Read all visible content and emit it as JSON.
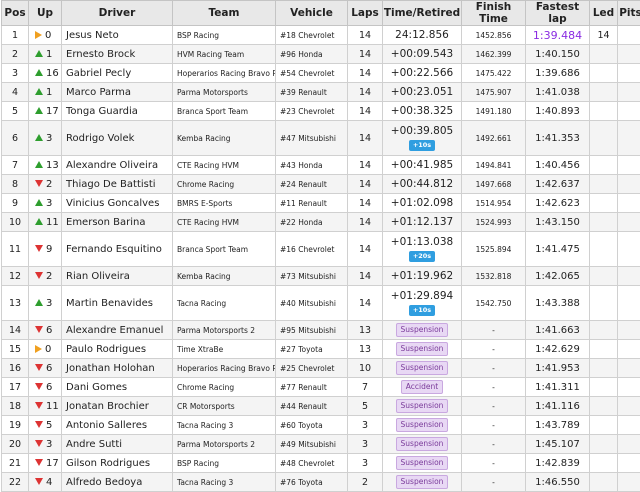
{
  "headers": [
    "Pos",
    "Up",
    "Driver",
    "Team",
    "Vehicle",
    "Laps",
    "Time/Retired",
    "Finish Time",
    "Fastest lap",
    "Led",
    "Pits"
  ],
  "rows": [
    {
      "pos": "1",
      "dir": "same",
      "up": "0",
      "driver": "Jesus Neto",
      "team": "BSP Racing",
      "vehicle": "#18 Chevrolet",
      "laps": "14",
      "time": "24:12.856",
      "finish": "1452.856",
      "fast": "1:39.484",
      "led": "14",
      "pits": "",
      "best": true
    },
    {
      "pos": "2",
      "dir": "up",
      "up": "1",
      "driver": "Ernesto Brock",
      "team": "HVM Racing Team",
      "vehicle": "#96 Honda",
      "laps": "14",
      "time": "+00:09.543",
      "finish": "1462.399",
      "fast": "1:40.150",
      "led": "",
      "pits": ""
    },
    {
      "pos": "3",
      "dir": "up",
      "up": "16",
      "driver": "Gabriel Pecly",
      "team": "Hoperarios Racing Bravo Racing",
      "vehicle": "#54 Chevrolet",
      "laps": "14",
      "time": "+00:22.566",
      "finish": "1475.422",
      "fast": "1:39.686",
      "led": "",
      "pits": ""
    },
    {
      "pos": "4",
      "dir": "up",
      "up": "1",
      "driver": "Marco Parma",
      "team": "Parma Motorsports",
      "vehicle": "#39 Renault",
      "laps": "14",
      "time": "+00:23.051",
      "finish": "1475.907",
      "fast": "1:41.038",
      "led": "",
      "pits": ""
    },
    {
      "pos": "5",
      "dir": "up",
      "up": "17",
      "driver": "Tonga Guardia",
      "team": "Branca Sport Team",
      "vehicle": "#23 Chevrolet",
      "laps": "14",
      "time": "+00:38.325",
      "finish": "1491.180",
      "fast": "1:40.893",
      "led": "",
      "pits": ""
    },
    {
      "pos": "6",
      "dir": "up",
      "up": "3",
      "driver": "Rodrigo Volek",
      "team": "Kemba Racing",
      "vehicle": "#47 Mitsubishi",
      "laps": "14",
      "time": "+00:39.805",
      "penalty": "+10s",
      "finish": "1492.661",
      "fast": "1:41.353",
      "led": "",
      "pits": ""
    },
    {
      "pos": "7",
      "dir": "up",
      "up": "13",
      "driver": "Alexandre Oliveira",
      "team": "CTE Racing HVM",
      "vehicle": "#43 Honda",
      "laps": "14",
      "time": "+00:41.985",
      "finish": "1494.841",
      "fast": "1:40.456",
      "led": "",
      "pits": ""
    },
    {
      "pos": "8",
      "dir": "down",
      "up": "2",
      "driver": "Thiago De Battisti",
      "team": "Chrome Racing",
      "vehicle": "#24 Renault",
      "laps": "14",
      "time": "+00:44.812",
      "finish": "1497.668",
      "fast": "1:42.637",
      "led": "",
      "pits": ""
    },
    {
      "pos": "9",
      "dir": "up",
      "up": "3",
      "driver": "Vinicius Goncalves",
      "team": "BMRS E-Sports",
      "vehicle": "#11 Renault",
      "laps": "14",
      "time": "+01:02.098",
      "finish": "1514.954",
      "fast": "1:42.623",
      "led": "",
      "pits": ""
    },
    {
      "pos": "10",
      "dir": "up",
      "up": "11",
      "driver": "Emerson Barina",
      "team": "CTE Racing HVM",
      "vehicle": "#22 Honda",
      "laps": "14",
      "time": "+01:12.137",
      "finish": "1524.993",
      "fast": "1:43.150",
      "led": "",
      "pits": ""
    },
    {
      "pos": "11",
      "dir": "down",
      "up": "9",
      "driver": "Fernando Esquitino",
      "team": "Branca Sport Team",
      "vehicle": "#16 Chevrolet",
      "laps": "14",
      "time": "+01:13.038",
      "penalty": "+20s",
      "finish": "1525.894",
      "fast": "1:41.475",
      "led": "",
      "pits": ""
    },
    {
      "pos": "12",
      "dir": "down",
      "up": "2",
      "driver": "Rian Oliveira",
      "team": "Kemba Racing",
      "vehicle": "#73 Mitsubishi",
      "laps": "14",
      "time": "+01:19.962",
      "finish": "1532.818",
      "fast": "1:42.065",
      "led": "",
      "pits": ""
    },
    {
      "pos": "13",
      "dir": "up",
      "up": "3",
      "driver": "Martin Benavides",
      "team": "Tacna Racing",
      "vehicle": "#40 Mitsubishi",
      "laps": "14",
      "time": "+01:29.894",
      "penalty": "+10s",
      "finish": "1542.750",
      "fast": "1:43.388",
      "led": "",
      "pits": ""
    },
    {
      "pos": "14",
      "dir": "down",
      "up": "6",
      "driver": "Alexandre Emanuel",
      "team": "Parma Motorsports 2",
      "vehicle": "#95 Mitsubishi",
      "laps": "13",
      "status": "Suspension",
      "finish": "-",
      "fast": "1:41.663",
      "led": "",
      "pits": ""
    },
    {
      "pos": "15",
      "dir": "same",
      "up": "0",
      "driver": "Paulo Rodrigues",
      "team": "Time XtraBe",
      "vehicle": "#27 Toyota",
      "laps": "13",
      "status": "Suspension",
      "finish": "-",
      "fast": "1:42.629",
      "led": "",
      "pits": ""
    },
    {
      "pos": "16",
      "dir": "down",
      "up": "6",
      "driver": "Jonathan Holohan",
      "team": "Hoperarios Racing Bravo Racing",
      "vehicle": "#25 Chevrolet",
      "laps": "10",
      "status": "Suspension",
      "finish": "-",
      "fast": "1:41.953",
      "led": "",
      "pits": ""
    },
    {
      "pos": "17",
      "dir": "down",
      "up": "6",
      "driver": "Dani Gomes",
      "team": "Chrome Racing",
      "vehicle": "#77 Renault",
      "laps": "7",
      "status": "Accident",
      "finish": "-",
      "fast": "1:41.311",
      "led": "",
      "pits": ""
    },
    {
      "pos": "18",
      "dir": "down",
      "up": "11",
      "driver": "Jonatan Brochier",
      "team": "CR Motorsports",
      "vehicle": "#44 Renault",
      "laps": "5",
      "status": "Suspension",
      "finish": "-",
      "fast": "1:41.116",
      "led": "",
      "pits": ""
    },
    {
      "pos": "19",
      "dir": "down",
      "up": "5",
      "driver": "Antonio Salleres",
      "team": "Tacna Racing 3",
      "vehicle": "#60 Toyota",
      "laps": "3",
      "status": "Suspension",
      "finish": "-",
      "fast": "1:43.789",
      "led": "",
      "pits": ""
    },
    {
      "pos": "20",
      "dir": "down",
      "up": "3",
      "driver": "Andre Sutti",
      "team": "Parma Motorsports 2",
      "vehicle": "#49 Mitsubishi",
      "laps": "3",
      "status": "Suspension",
      "finish": "-",
      "fast": "1:45.107",
      "led": "",
      "pits": ""
    },
    {
      "pos": "21",
      "dir": "down",
      "up": "17",
      "driver": "Gilson Rodrigues",
      "team": "BSP Racing",
      "vehicle": "#48 Chevrolet",
      "laps": "3",
      "status": "Suspension",
      "finish": "-",
      "fast": "1:42.839",
      "led": "",
      "pits": ""
    },
    {
      "pos": "22",
      "dir": "down",
      "up": "4",
      "driver": "Alfredo Bedoya",
      "team": "Tacna Racing 3",
      "vehicle": "#76 Toyota",
      "laps": "2",
      "status": "Suspension",
      "finish": "-",
      "fast": "1:46.550",
      "led": "",
      "pits": ""
    }
  ]
}
